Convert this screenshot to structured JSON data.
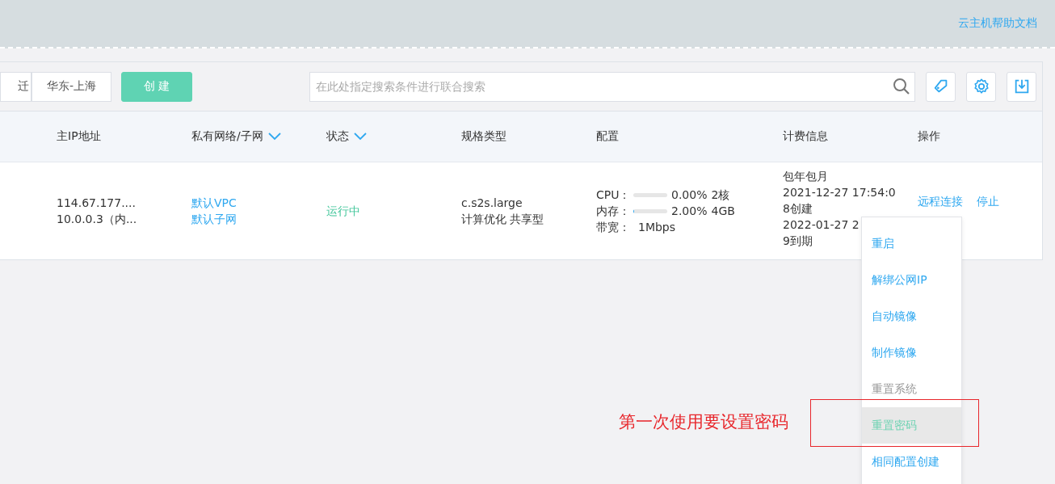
{
  "header": {
    "help_link": "云主机帮助文档"
  },
  "toolbar": {
    "buttons": [
      {
        "label": "迁",
        "kind": "plain"
      },
      {
        "label": "华东-上海",
        "kind": "plain"
      },
      {
        "label": "创 建",
        "kind": "primary"
      }
    ],
    "search": {
      "placeholder": "在此处指定搜索条件进行联合搜索"
    }
  },
  "table": {
    "columns": [
      {
        "label": "主IP地址",
        "filter": false
      },
      {
        "label": "私有网络/子网",
        "filter": true
      },
      {
        "label": "状态",
        "filter": true
      },
      {
        "label": "规格类型",
        "filter": false
      },
      {
        "label": "配置",
        "filter": false
      },
      {
        "label": "计费信息",
        "filter": false
      },
      {
        "label": "操作",
        "filter": false
      }
    ],
    "rows": [
      {
        "ip": [
          "114.67.177....",
          "10.0.0.3（内..."
        ],
        "network": [
          "默认VPC",
          "默认子网"
        ],
        "status": "运行中",
        "spec": [
          "c.s2s.large",
          "计算优化 共享型"
        ],
        "config": [
          {
            "label": "CPU：",
            "kind": "meter",
            "level": 0,
            "percent": "0.00%",
            "amount": "2核"
          },
          {
            "label": "内存：",
            "kind": "meter",
            "level": 0.02,
            "percent": "2.00%",
            "amount": "4GB"
          },
          {
            "label": "带宽：",
            "kind": "text",
            "value": "1Mbps"
          }
        ],
        "billing": [
          "包年包月",
          "2021-12-27 17:54:0",
          "8创建",
          "2022-01-27 2",
          "9到期"
        ],
        "actions": [
          "远程连接",
          "停止"
        ]
      }
    ]
  },
  "menu": {
    "items": [
      {
        "label": "重启",
        "disabled": false,
        "hovered": false
      },
      {
        "label": "解绑公网IP",
        "disabled": false,
        "hovered": false
      },
      {
        "label": "自动镜像",
        "disabled": false,
        "hovered": false
      },
      {
        "label": "制作镜像",
        "disabled": false,
        "hovered": false
      },
      {
        "label": "重置系统",
        "disabled": true,
        "hovered": false
      },
      {
        "label": "重置密码",
        "disabled": false,
        "hovered": true
      },
      {
        "label": "相同配置创建",
        "disabled": false,
        "hovered": false
      }
    ]
  },
  "annotation": {
    "text": "第一次使用要设置密码"
  }
}
